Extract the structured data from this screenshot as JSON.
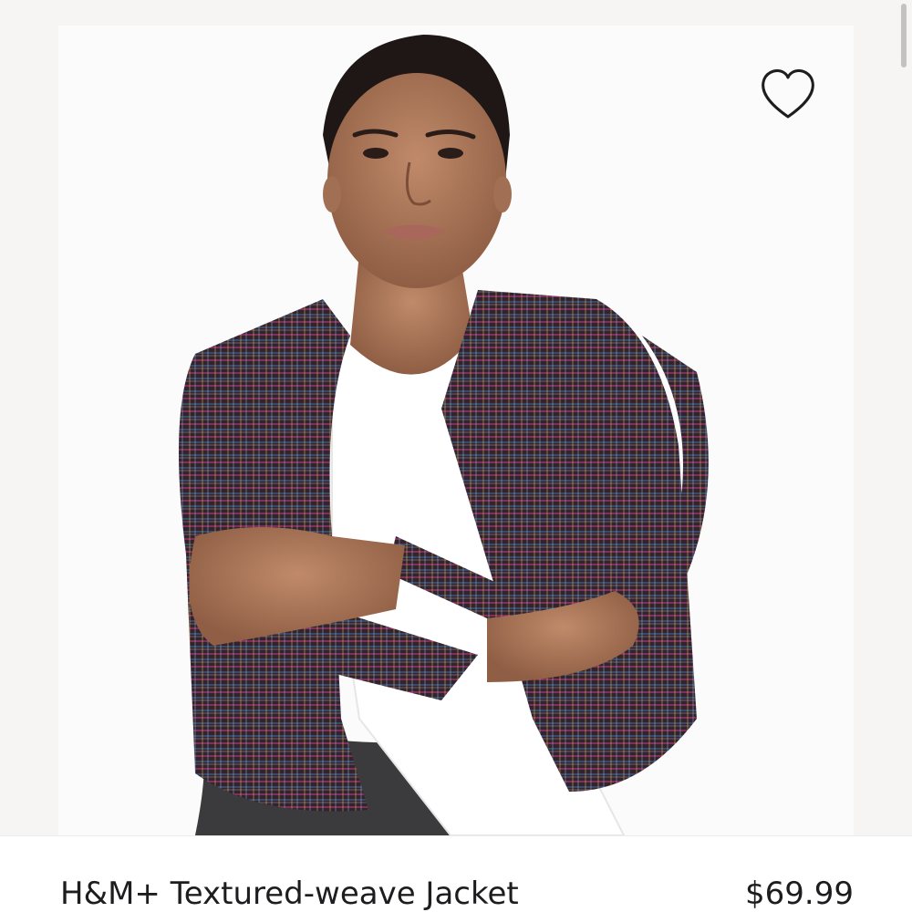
{
  "product": {
    "name": "H&M+ Textured-weave Jacket",
    "price": "$69.99",
    "image_alt": "Model wearing a multicolored tweed jacket over a white top",
    "favorite_icon": "heart-outline-icon"
  },
  "colors": {
    "page_background": "#f7f5f3",
    "image_background": "#fbfbfb",
    "text": "#1d1d1f",
    "jacket": "#3a2a38",
    "jacket_accent_pink": "#d13a8a",
    "jacket_accent_blue": "#4a7fc0",
    "jacket_accent_yellow": "#d8c24a"
  }
}
